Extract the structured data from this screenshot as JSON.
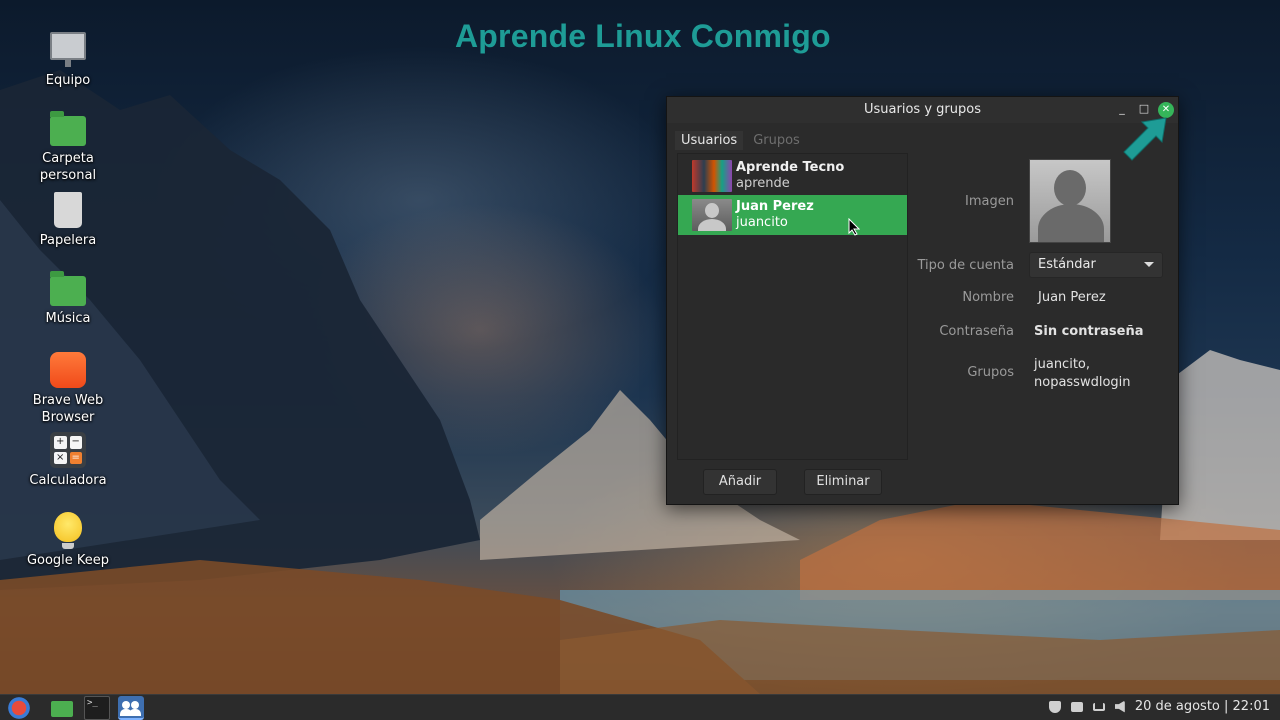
{
  "desktop": {
    "title": "Aprende Linux Conmigo",
    "icons": [
      {
        "label": "Equipo",
        "icon": "computer-icon"
      },
      {
        "label": "Carpeta\npersonal",
        "icon": "home-folder-icon"
      },
      {
        "label": "Papelera",
        "icon": "trash-icon"
      },
      {
        "label": "Música",
        "icon": "music-folder-icon"
      },
      {
        "label": "Brave Web\nBrowser",
        "icon": "brave-icon"
      },
      {
        "label": "Calculadora",
        "icon": "calculator-icon"
      },
      {
        "label": "Google Keep",
        "icon": "lightbulb-icon"
      }
    ]
  },
  "window": {
    "title": "Usuarios y grupos",
    "tabs": [
      {
        "label": "Usuarios",
        "active": true
      },
      {
        "label": "Grupos",
        "active": false
      }
    ],
    "users": [
      {
        "name": "Aprende Tecno",
        "username": "aprende",
        "selected": false
      },
      {
        "name": "Juan Perez",
        "username": "juancito",
        "selected": true
      }
    ],
    "buttons": {
      "add": "Añadir",
      "remove": "Eliminar"
    },
    "details": {
      "image_label": "Imagen",
      "account_type_label": "Tipo de cuenta",
      "account_type_value": "Estándar",
      "name_label": "Nombre",
      "name_value": "Juan Perez",
      "password_label": "Contraseña",
      "password_value": "Sin contraseña",
      "groups_label": "Grupos",
      "groups_value_line1": "juancito,",
      "groups_value_line2": "nopasswdlogin"
    },
    "selection_color": "#35a852",
    "close_button_color": "#35b55a"
  },
  "annotation": {
    "arrow_color": "#1e9c96",
    "arrow_icon": "arrow-up-right-icon"
  },
  "taskbar": {
    "items": [
      "menu-icon",
      "files-icon",
      "terminal-icon",
      "users-groups-icon"
    ],
    "terminal_glyph": ">_",
    "tray_icons": [
      "shield-icon",
      "printer-icon",
      "network-icon",
      "volume-icon"
    ],
    "clock": "20 de agosto | 22:01"
  }
}
